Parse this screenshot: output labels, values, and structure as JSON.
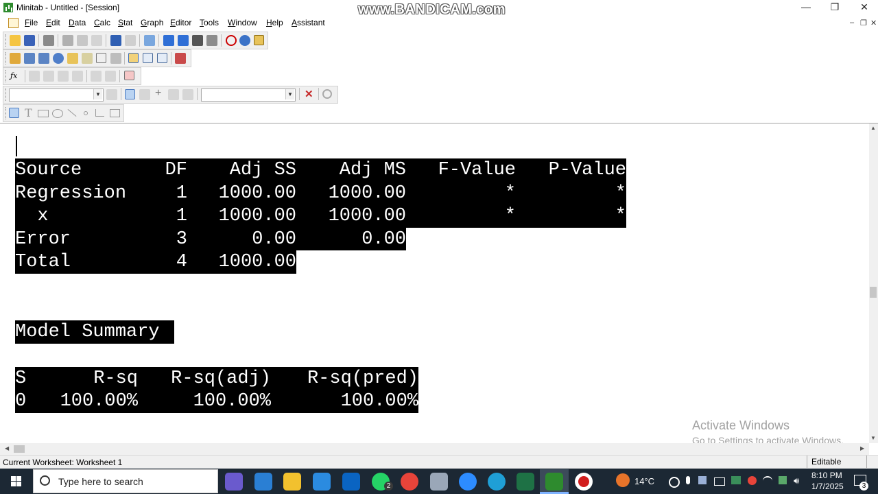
{
  "window": {
    "title": "Minitab - Untitled - [Session]",
    "watermark": "www.BANDICAM.com",
    "controls": {
      "minimize": "—",
      "restore": "❐",
      "close": "✕"
    },
    "mdi_controls": {
      "minimize": "–",
      "restore": "❐",
      "close": "✕"
    }
  },
  "menu": {
    "items": [
      {
        "label": "File",
        "key": "F"
      },
      {
        "label": "Edit",
        "key": "E"
      },
      {
        "label": "Data",
        "key": "D"
      },
      {
        "label": "Calc",
        "key": "C"
      },
      {
        "label": "Stat",
        "key": "S"
      },
      {
        "label": "Graph",
        "key": "G"
      },
      {
        "label": "Editor",
        "key": "E"
      },
      {
        "label": "Tools",
        "key": "T"
      },
      {
        "label": "Window",
        "key": "W"
      },
      {
        "label": "Help",
        "key": "H"
      },
      {
        "label": "Assistant",
        "key": "A"
      }
    ]
  },
  "toolbars": {
    "standard_icons": [
      "open-icon",
      "save-icon",
      "print-icon",
      "cut-icon",
      "copy-icon",
      "paste-icon",
      "undo-icon",
      "redo-icon",
      "edit-last-dialog-icon",
      "previous-icon",
      "next-icon",
      "find-icon",
      "replace-icon",
      "cancel-icon",
      "help-icon",
      "stat-guide-icon"
    ],
    "project_icons": [
      "session-folder-icon",
      "worksheet-folder-icon",
      "graphs-folder-icon",
      "info-icon",
      "history-icon",
      "report-pad-icon",
      "related-docs-icon",
      "design-icon",
      "show-session-icon",
      "show-data-icon",
      "show-graphs-icon",
      "close-graphs-icon"
    ],
    "worksheet_icons": [
      "fx-icon",
      "insert-row-icon",
      "insert-column-icon",
      "move-columns-icon",
      "clear-icon",
      "brush-icon",
      "subset-icon",
      "eraser-icon"
    ],
    "graph_editing": {
      "combo1_value": "",
      "combo2_value": "",
      "icons": [
        "select-icon",
        "brush-icon",
        "crosshair-icon",
        "flag-icon",
        "swap-icon",
        "delete-icon",
        "zoom-icon"
      ]
    },
    "annotation_icons": [
      "pointer-icon",
      "text-icon",
      "rectangle-icon",
      "ellipse-icon",
      "line-icon",
      "marker-icon",
      "polyline-icon",
      "polygon-icon"
    ]
  },
  "session": {
    "anova": {
      "headers": [
        "Source",
        "DF",
        "Adj SS",
        "Adj MS",
        "F-Value",
        "P-Value"
      ],
      "rows": [
        [
          "Regression",
          "1",
          "1000.00",
          "1000.00",
          "*",
          "*"
        ],
        [
          "  x",
          "1",
          "1000.00",
          "1000.00",
          "*",
          "*"
        ],
        [
          "Error",
          "3",
          "0.00",
          "0.00",
          "",
          ""
        ],
        [
          "Total",
          "4",
          "1000.00",
          "",
          "",
          ""
        ]
      ]
    },
    "model_summary": {
      "heading": "Model Summary",
      "headers": [
        "S",
        "R-sq",
        "R-sq(adj)",
        "R-sq(pred)"
      ],
      "values": [
        "0",
        "100.00%",
        "100.00%",
        "100.00%"
      ]
    },
    "activate": {
      "line1": "Activate Windows",
      "line2": "Go to Settings to activate Windows."
    }
  },
  "statusbar": {
    "worksheet": "Current Worksheet: Worksheet 1",
    "mode": "Editable"
  },
  "taskbar": {
    "search_placeholder": "Type here to search",
    "apps": [
      {
        "name": "copilot-icon",
        "color": "#6a5acd"
      },
      {
        "name": "network-app-icon",
        "color": "#2a7fd4"
      },
      {
        "name": "file-explorer-icon",
        "color": "#f2c12e"
      },
      {
        "name": "store-icon",
        "color": "#2b8be0"
      },
      {
        "name": "outlook-icon",
        "color": "#0a64c2"
      },
      {
        "name": "whatsapp-icon",
        "color": "#25d366"
      },
      {
        "name": "chrome-icon",
        "color": "#e8443a"
      },
      {
        "name": "paint-icon",
        "color": "#9aa7b8"
      },
      {
        "name": "zoom-icon",
        "color": "#2d8cff"
      },
      {
        "name": "edge-icon",
        "color": "#1f9fd6"
      },
      {
        "name": "excel-icon",
        "color": "#1e7145"
      },
      {
        "name": "minitab-icon",
        "color": "#2e8b2e"
      },
      {
        "name": "bandicam-icon",
        "color": "#d21e1e"
      }
    ],
    "whatsapp_badge": "2",
    "weather": "14°C",
    "time": "8:10 PM",
    "date": "1/7/2025",
    "notification_count": "3"
  }
}
